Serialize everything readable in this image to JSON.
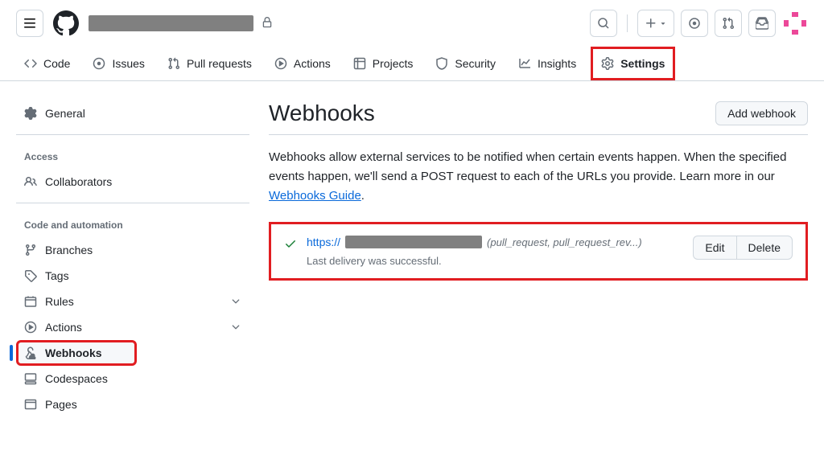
{
  "repo_nav": {
    "code": "Code",
    "issues": "Issues",
    "pull_requests": "Pull requests",
    "actions": "Actions",
    "projects": "Projects",
    "security": "Security",
    "insights": "Insights",
    "settings": "Settings"
  },
  "sidebar": {
    "general": "General",
    "access_heading": "Access",
    "collaborators": "Collaborators",
    "code_automation_heading": "Code and automation",
    "branches": "Branches",
    "tags": "Tags",
    "rules": "Rules",
    "actions": "Actions",
    "webhooks": "Webhooks",
    "codespaces": "Codespaces",
    "pages": "Pages"
  },
  "page": {
    "title": "Webhooks",
    "add_button": "Add webhook",
    "description1": "Webhooks allow external services to be notified when certain events happen. When the specified events happen, we'll send a POST request to each of the URLs you provide. Learn more in our ",
    "guide_link": "Webhooks Guide",
    "description2": "."
  },
  "webhook": {
    "protocol": "https://",
    "events": "(pull_request, pull_request_rev...)",
    "status": "Last delivery was successful.",
    "edit": "Edit",
    "delete": "Delete"
  }
}
